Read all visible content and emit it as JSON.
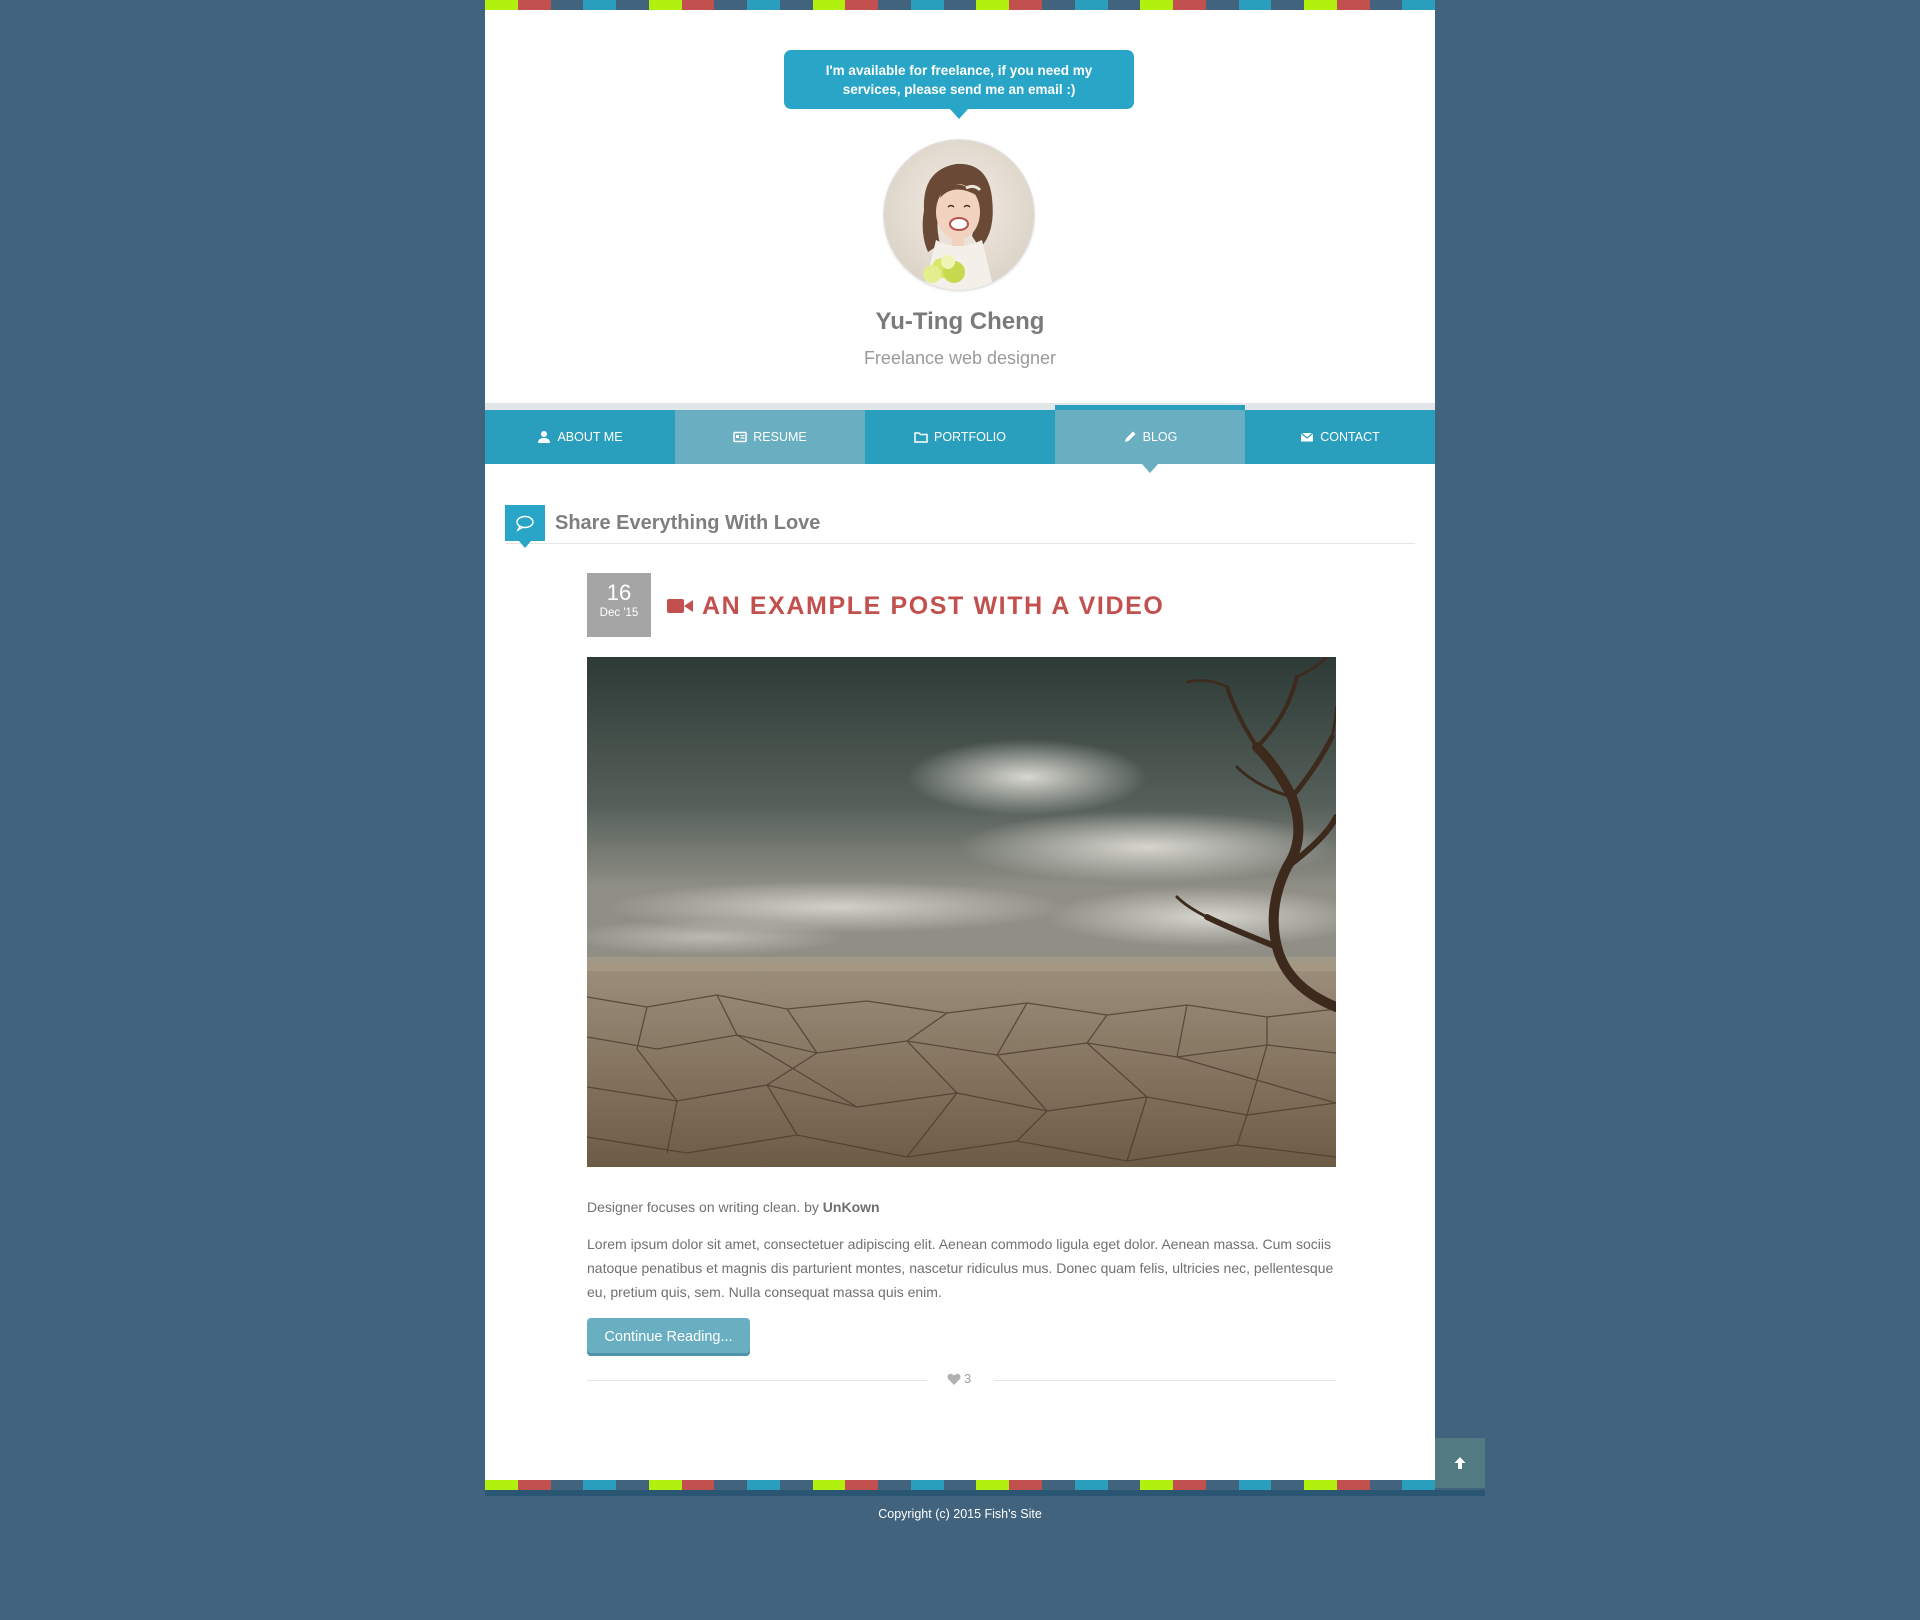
{
  "colors": {
    "background": "#41637d",
    "accent_blue": "#2a9fbd",
    "accent_light": "#6aaec2",
    "post_title": "#c1504e",
    "stripe": [
      "#b2f00f",
      "#c1504e",
      "#41637d",
      "#2a9fbd",
      "#41637d",
      "#b2f00f",
      "#c1504e",
      "#41637d",
      "#2a9fbd",
      "#41637d"
    ]
  },
  "header": {
    "bubble_text": "I'm available for freelance, if you need my services, please send me an email :)",
    "name": "Yu-Ting Cheng",
    "role": "Freelance web designer"
  },
  "nav": {
    "items": [
      {
        "label": "About Me",
        "icon": "user-icon"
      },
      {
        "label": "Resume",
        "icon": "resume-icon"
      },
      {
        "label": "Portfolio",
        "icon": "folder-icon"
      },
      {
        "label": "Blog",
        "icon": "pencil-icon",
        "active": true
      },
      {
        "label": "Contact",
        "icon": "envelope-icon"
      }
    ]
  },
  "section": {
    "title": "Share Everything With Love",
    "icon": "speech-bubble-icon"
  },
  "post": {
    "date_day": "16",
    "date_month": "Dec '15",
    "title": "An Example Post With A Video",
    "title_icon": "video-camera-icon",
    "byline_text": "Designer focuses on writing clean. by ",
    "byline_author": "UnKown",
    "excerpt": "Lorem ipsum dolor sit amet, consectetuer adipiscing elit. Aenean commodo ligula eget dolor. Aenean massa. Cum sociis natoque penatibus et magnis dis parturient montes, nascetur ridiculus mus. Donec quam felis, ultricies nec, pellentesque eu, pretium quis, sem. Nulla consequat massa quis enim.",
    "continue_label": "Continue Reading...",
    "likes": "3"
  },
  "footer": {
    "copyright": "Copyright (c) 2015 Fish's Site"
  }
}
